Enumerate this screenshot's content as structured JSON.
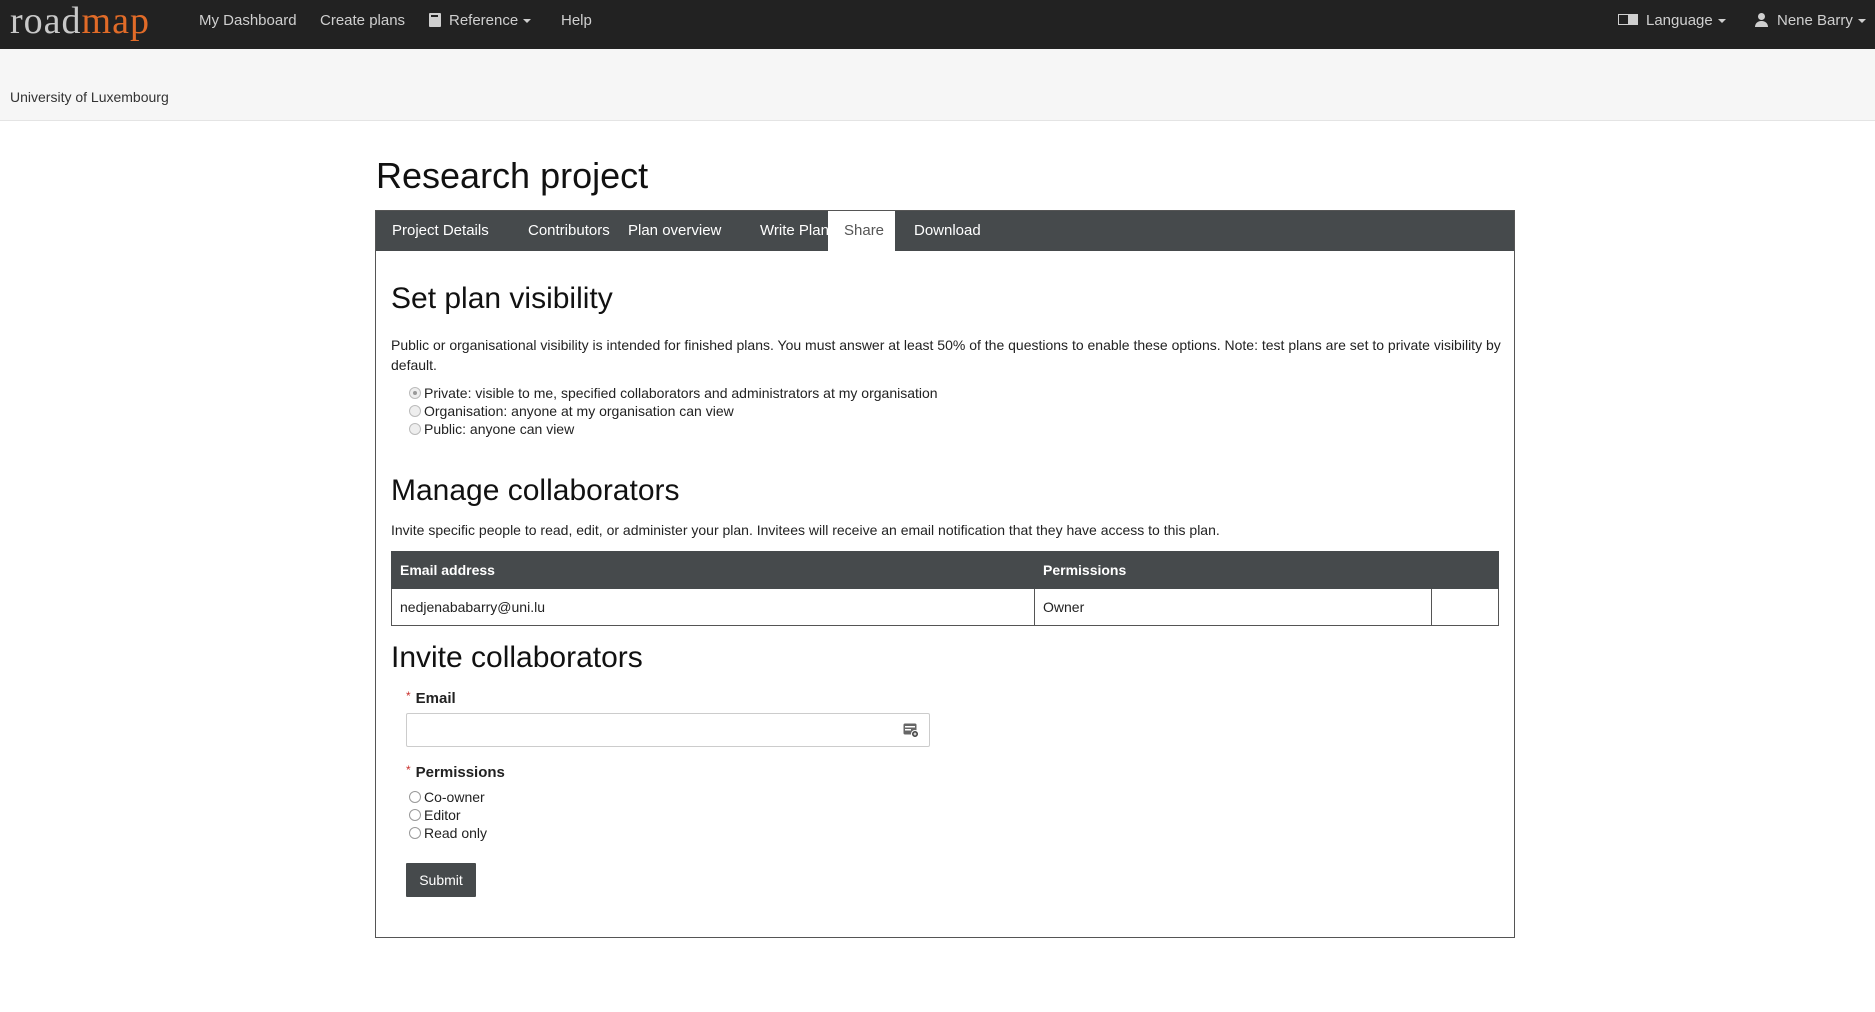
{
  "brand": {
    "part1": "road",
    "part2": "map"
  },
  "nav": {
    "dashboard": "My Dashboard",
    "create_plans": "Create plans",
    "reference": "Reference",
    "help": "Help",
    "language": "Language",
    "user": "Nene Barry"
  },
  "org": {
    "name": "University of Luxembourg"
  },
  "page": {
    "title": "Research project"
  },
  "tabs": [
    {
      "label": "Project Details"
    },
    {
      "label": "Contributors"
    },
    {
      "label": "Plan overview"
    },
    {
      "label": "Write Plan"
    },
    {
      "label": "Share",
      "active": true
    },
    {
      "label": "Download"
    }
  ],
  "visibility": {
    "heading": "Set plan visibility",
    "description": "Public or organisational visibility is intended for finished plans. You must answer at least 50% of the questions to enable these options. Note: test plans are set to private visibility by default.",
    "options": [
      {
        "label": "Private: visible to me, specified collaborators and administrators at my organisation",
        "checked": true
      },
      {
        "label": "Organisation: anyone at my organisation can view",
        "checked": false
      },
      {
        "label": "Public: anyone can view",
        "checked": false
      }
    ]
  },
  "manage": {
    "heading": "Manage collaborators",
    "description": "Invite specific people to read, edit, or administer your plan. Invitees will receive an email notification that they have access to this plan.",
    "columns": [
      "Email address",
      "Permissions",
      ""
    ],
    "rows": [
      {
        "email": "nedjenababarry@uni.lu",
        "permission": "Owner"
      }
    ]
  },
  "invite": {
    "heading": "Invite collaborators",
    "required_mark": "*",
    "email_label": "Email",
    "email_value": "",
    "permissions_label": "Permissions",
    "permission_options": [
      "Co-owner",
      "Editor",
      "Read only"
    ],
    "submit_label": "Submit"
  },
  "colors": {
    "navbar": "#222222",
    "brand_accent": "#e16b28",
    "tab_bar": "#464a4c",
    "required": "#c9302c"
  }
}
